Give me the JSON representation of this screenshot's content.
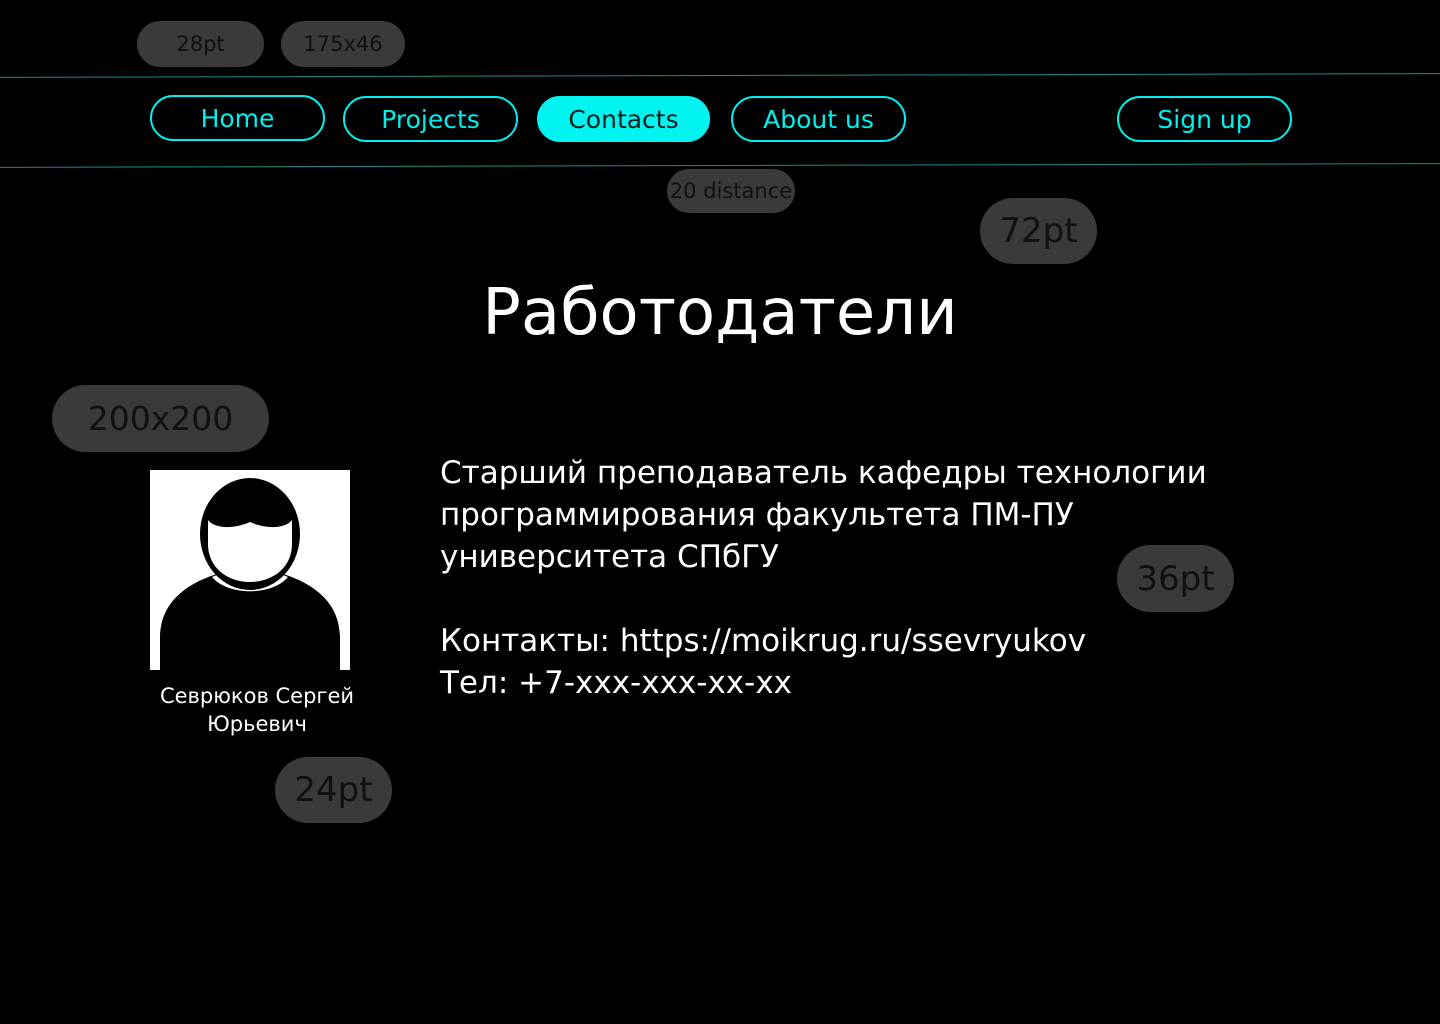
{
  "annotations": {
    "font_size_nav": "28pt",
    "button_size": "175x46",
    "distance": "20 distance",
    "font_size_title": "72pt",
    "avatar_size": "200x200",
    "font_size_body": "36pt",
    "font_size_name": "24pt"
  },
  "nav": {
    "items": [
      {
        "label": "Home",
        "active": false
      },
      {
        "label": "Projects",
        "active": false
      },
      {
        "label": "Contacts",
        "active": true
      },
      {
        "label": "About us",
        "active": false
      }
    ],
    "signup_label": "Sign up"
  },
  "page": {
    "title": "Работодатели"
  },
  "person": {
    "name": "Севрюков Сергей Юрьевич",
    "description": "Старший преподаватель кафедры технологии программирования факультета ПМ-ПУ университета СПбГУ",
    "contacts": "Контакты: https://moikrug.ru/ssevryukov",
    "phone": "Тел: +7-xxx-xxx-xx-xx"
  },
  "colors": {
    "background": "#000000",
    "accent": "#00f0ee",
    "annotation_bubble": "#3a3a3a",
    "text": "#ffffff"
  },
  "icons": {
    "avatar": "person-silhouette-icon"
  }
}
